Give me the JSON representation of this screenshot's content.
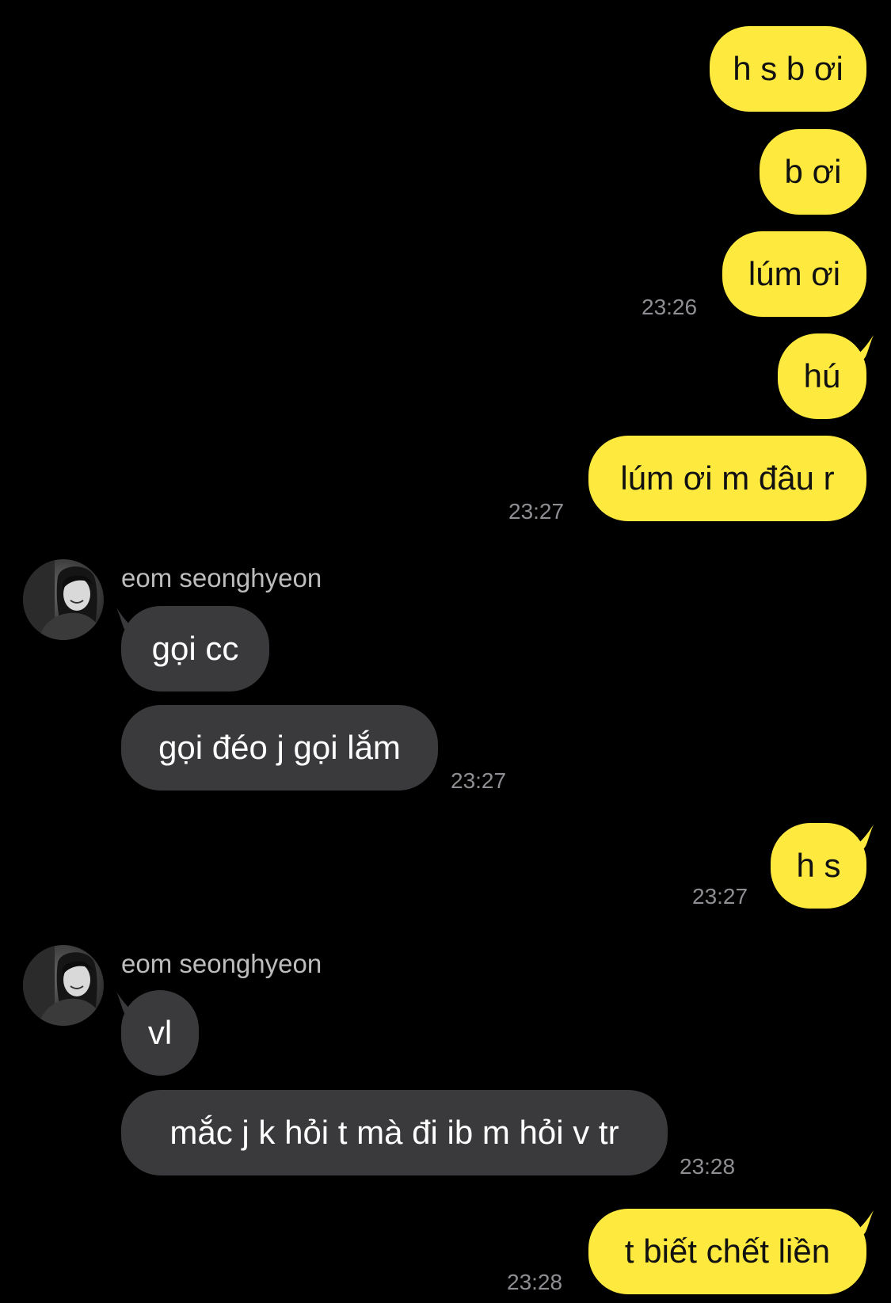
{
  "colors": {
    "background": "#000000",
    "outgoing_bubble": "#FEE93F",
    "outgoing_text": "#111111",
    "incoming_bubble": "#3A3A3C",
    "incoming_text": "#FFFFFF",
    "timestamp": "#8E8E93",
    "sender_name": "#BDBDBD"
  },
  "messages": {
    "m1": {
      "text": "h s b ơi"
    },
    "m2": {
      "text": "b ơi"
    },
    "m3": {
      "text": "lúm ơi",
      "time": "23:26"
    },
    "m4": {
      "text": "hú"
    },
    "m5": {
      "text": "lúm ơi m đâu r",
      "time": "23:27"
    },
    "g1": {
      "sender": "eom seonghyeon",
      "avatar_icon": "profile-photo",
      "m6": {
        "text": "gọi cc"
      },
      "m7": {
        "text": "gọi đéo j gọi lắm",
        "time": "23:27"
      }
    },
    "m8": {
      "text": "h s",
      "time": "23:27"
    },
    "g2": {
      "sender": "eom seonghyeon",
      "avatar_icon": "profile-photo",
      "m9": {
        "text": "vl"
      },
      "m10": {
        "text": "mắc j k hỏi t mà đi ib m hỏi v tr",
        "time": "23:28"
      }
    },
    "m11": {
      "text": "t biết chết liền",
      "time": "23:28"
    }
  }
}
